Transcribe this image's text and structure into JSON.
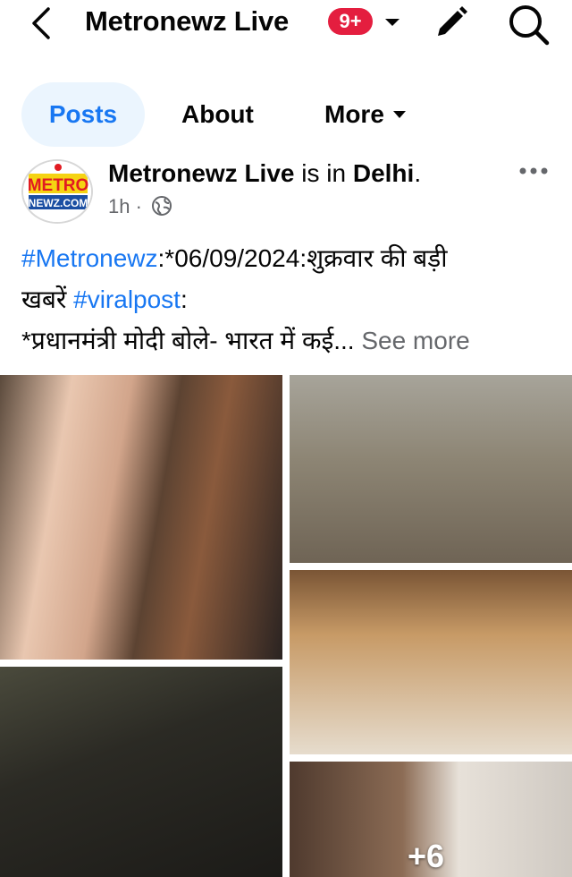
{
  "header": {
    "page_name": "Metronewz Live",
    "notification_badge": "9+",
    "badge_color": "#e41e3f",
    "icons": [
      "back-icon",
      "caret-down-icon",
      "edit-icon",
      "search-icon"
    ]
  },
  "tabs": [
    {
      "label": "Posts",
      "active": true
    },
    {
      "label": "About",
      "active": false
    },
    {
      "label": "More",
      "active": false
    }
  ],
  "post": {
    "author": "Metronewz Live",
    "location_prefix": " is in ",
    "location": "Delhi",
    "location_suffix": ".",
    "time": "1h",
    "separator": "·",
    "avatar": {
      "text_top": "METRO",
      "text_bottom": "NEWZ.COM"
    },
    "text": {
      "hashtag1": "#Metronewz",
      "line1_rest": ":*06/09/2024:शुक्रवार की बड़ी",
      "line2_start": "खबरें ",
      "hashtag2": "#viralpost",
      "line2_rest": ":",
      "line3": "*प्रधानमंत्री मोदी बोले- भारत में कई... ",
      "see_more": "See more"
    },
    "photos_extra_count": "+6"
  },
  "colors": {
    "accent": "#1877f2",
    "active_tab_bg": "#ebf5fe",
    "secondary_text": "#65676b"
  }
}
